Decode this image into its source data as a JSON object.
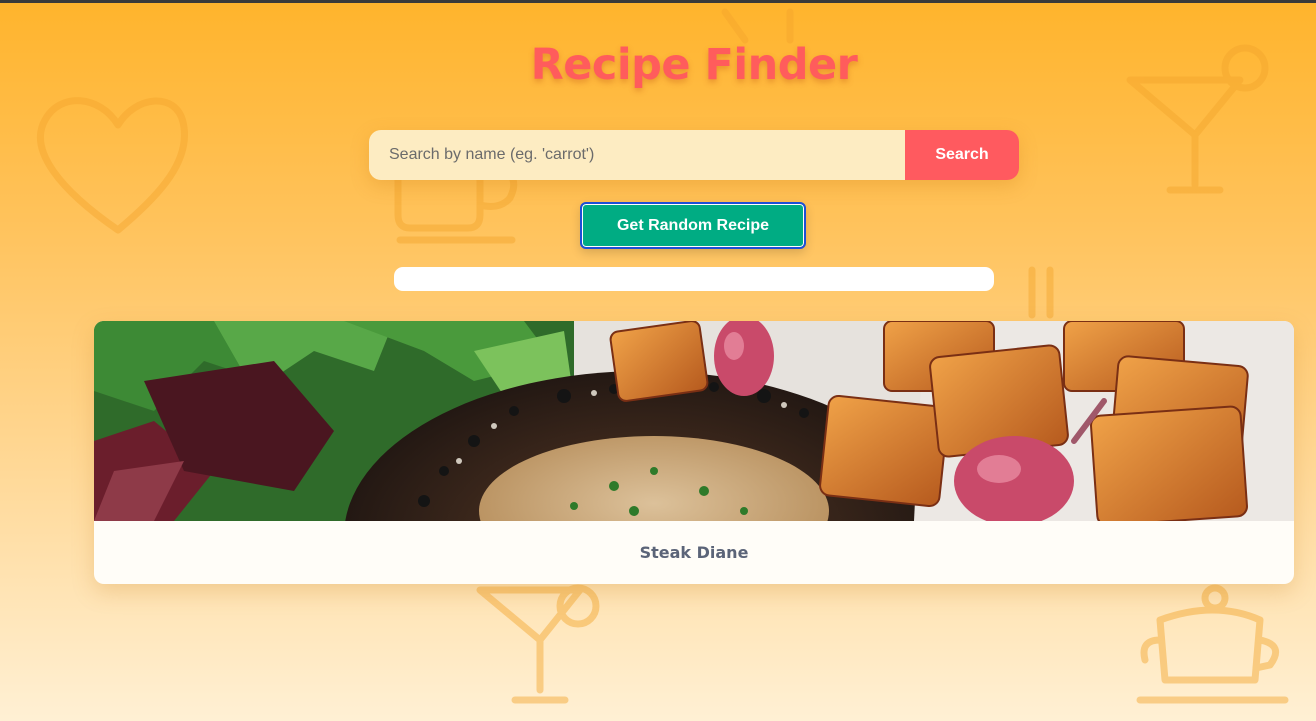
{
  "app": {
    "title": "Recipe Finder"
  },
  "search": {
    "placeholder": "Search by name (eg. 'carrot')",
    "value": "",
    "button_label": "Search"
  },
  "random": {
    "button_label": "Get Random Recipe"
  },
  "loading": {
    "progress": 0
  },
  "results": [
    {
      "name": "Steak Diane"
    }
  ],
  "background_icons": [
    "heart-icon",
    "cocktail-icon",
    "coffee-cup-icon",
    "fork-knife-icon",
    "teapot-icon"
  ],
  "colors": {
    "accent": "#ff5c5c",
    "search_button": "#ff5a5f",
    "random_button": "#00ac83",
    "background_top": "#ffb42c",
    "background_bottom": "#fff0d4"
  }
}
